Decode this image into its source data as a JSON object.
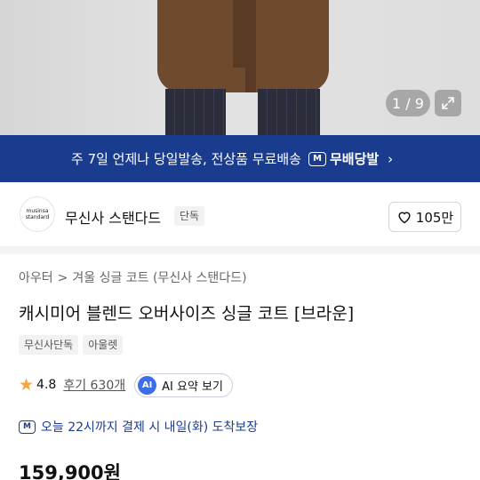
{
  "gallery": {
    "counter": "1 / 9",
    "expand_icon": "expand-icon"
  },
  "banner": {
    "text": "주 7일 언제나 당일발송, 전상품 무료배송",
    "logo": "M",
    "brand": "무배당발",
    "chevron": "›",
    "background_color": "#1a3c8f"
  },
  "store": {
    "avatar_line1": "musinsa",
    "avatar_line2": "standard",
    "name": "무신사 스탠다드",
    "badge": "단독",
    "likes": "105만"
  },
  "breadcrumb": {
    "items": [
      "아우터",
      "겨울 싱글 코트 (무신사 스탠다드)"
    ],
    "separator": ">"
  },
  "product": {
    "title": "캐시미어 블렌드 오버사이즈 싱글 코트 [브라운]",
    "tags": [
      "무신사단독",
      "아울렛"
    ],
    "rating": "4.8",
    "reviews": "후기 630개",
    "ai_badge": "AI",
    "ai_label": "AI 요약 보기",
    "delivery_logo": "M",
    "delivery_text": "오늘 22시까지 결제 시 내일(화) 도착보장",
    "price": "159,900원"
  },
  "colors": {
    "accent_blue": "#1a3c8f",
    "star": "#f3a73b",
    "ai_blue": "#3b6ee8"
  }
}
